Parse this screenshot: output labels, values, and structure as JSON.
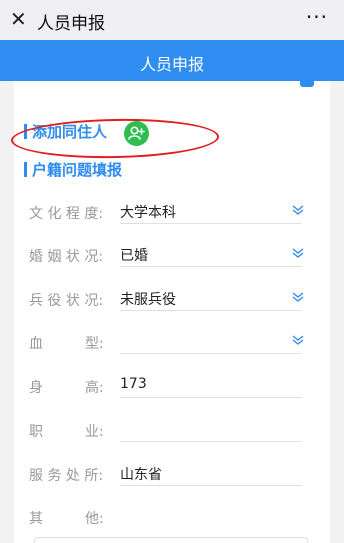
{
  "titlebar": {
    "close_icon": "close-icon",
    "title": "人员申报",
    "more": "···"
  },
  "header": {
    "title": "人员申报"
  },
  "sections": {
    "add_cohabitant": "添加同住人",
    "household_issue": "户籍问题填报"
  },
  "fields": [
    {
      "label": "文 化 程 度:",
      "value": "大学本科",
      "dropdown": true
    },
    {
      "label": "婚 姻 状 况:",
      "value": "已婚",
      "dropdown": true
    },
    {
      "label": "兵 役 状 况:",
      "value": "未服兵役",
      "dropdown": true
    },
    {
      "label": "血　　　型:",
      "value": "",
      "dropdown": true
    },
    {
      "label": "身　　　高:",
      "value": "173",
      "dropdown": false
    },
    {
      "label": "职　　　业:",
      "value": "",
      "dropdown": false
    },
    {
      "label": "服 务 处 所:",
      "value": "山东省",
      "dropdown": false
    },
    {
      "label": "其　　　他:",
      "value": "",
      "dropdown": false
    }
  ],
  "colors": {
    "accent": "#2f8cf0",
    "add_icon": "#2ebd4f",
    "annotation": "#e02020"
  }
}
